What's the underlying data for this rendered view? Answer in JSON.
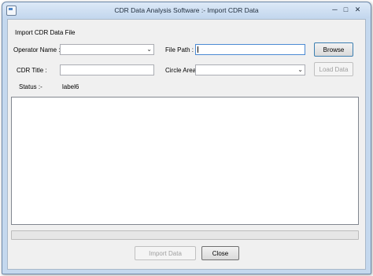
{
  "window": {
    "title": "CDR Data Analysis Software :- Import CDR Data"
  },
  "icons": {
    "app": "app-icon",
    "minimize": "minimize-icon",
    "maximize": "maximize-icon",
    "close": "close-icon",
    "dropdown": "chevron-down-icon"
  },
  "window_controls": {
    "minimize": "─",
    "maximize": "□",
    "close": "✕"
  },
  "group": {
    "title": "Import CDR Data File"
  },
  "form": {
    "operator_name": {
      "label": "Operator Name :",
      "value": ""
    },
    "cdr_title": {
      "label": "CDR Title :",
      "value": ""
    },
    "status": {
      "label": "Status :-",
      "value": "label6"
    },
    "file_path": {
      "label": "File Path :",
      "value": ""
    },
    "circle_area": {
      "label": "Circle Area :",
      "value": ""
    },
    "dropdown_glyph": "⌄"
  },
  "buttons": {
    "browse": "Browse",
    "load_data": "Load Data",
    "import_data": "Import Data",
    "close": "Close"
  },
  "list": {
    "items": []
  },
  "progress": {
    "value": 0
  }
}
